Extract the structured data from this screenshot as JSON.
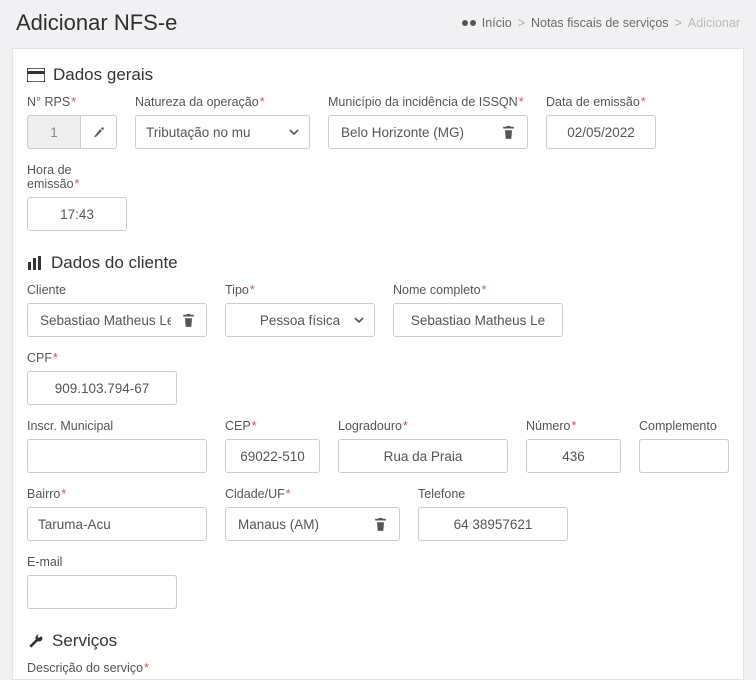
{
  "header": {
    "title": "Adicionar NFS-e",
    "breadcrumb": {
      "home": "Início",
      "mid": "Notas fiscais de serviços",
      "current": "Adicionar"
    }
  },
  "sections": {
    "general": "Dados gerais",
    "client": "Dados do cliente",
    "services": "Serviços"
  },
  "general": {
    "rps_label": "N° RPS",
    "rps_value": "1",
    "natureza_label": "Natureza da operação",
    "natureza_value": "Tributação no mu",
    "municipio_label": "Município da incidência de ISSQN",
    "municipio_value": "Belo Horizonte (MG)",
    "data_label": "Data de emissão",
    "data_value": "02/05/2022",
    "hora_label": "Hora de emissão",
    "hora_value": "17:43"
  },
  "client": {
    "cliente_label": "Cliente",
    "cliente_value": "Sebastiao Matheus Lean",
    "tipo_label": "Tipo",
    "tipo_value": "Pessoa física",
    "nome_label": "Nome completo",
    "nome_value": "Sebastiao Matheus Le",
    "cpf_label": "CPF",
    "cpf_value": "909.103.794-67",
    "inscr_label": "Inscr. Municipal",
    "inscr_value": "",
    "cep_label": "CEP",
    "cep_value": "69022-510",
    "logradouro_label": "Logradouro",
    "logradouro_value": "Rua da Praia",
    "numero_label": "Número",
    "numero_value": "436",
    "complemento_label": "Complemento",
    "complemento_value": "",
    "bairro_label": "Bairro",
    "bairro_value": "Taruma-Acu",
    "cidade_label": "Cidade/UF",
    "cidade_value": "Manaus (AM)",
    "telefone_label": "Telefone",
    "telefone_value": "64 38957621",
    "email_label": "E-mail",
    "email_value": ""
  },
  "services": {
    "descricao_label": "Descrição do serviço"
  }
}
